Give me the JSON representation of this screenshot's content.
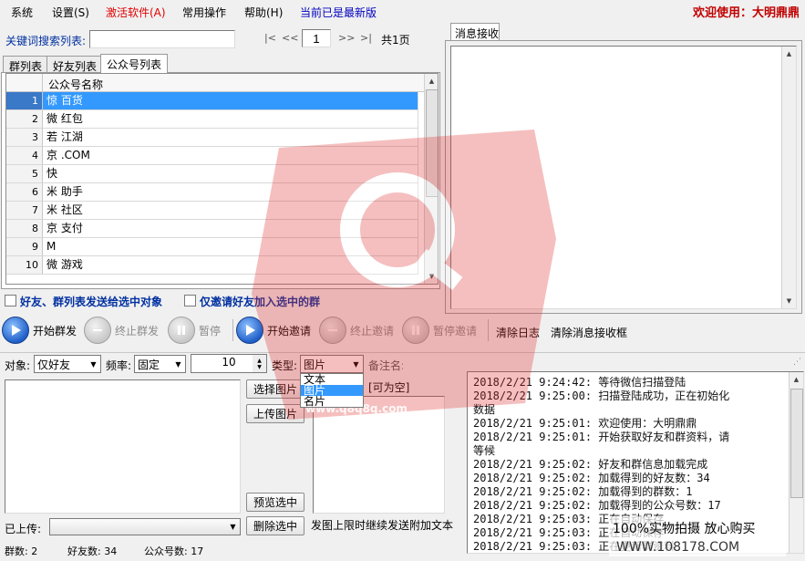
{
  "menu": {
    "items": [
      "系统",
      "设置(S)",
      "激活软件(A)",
      "常用操作",
      "帮助(H)",
      "当前已是最新版"
    ],
    "welcome": "欢迎使用：大明鼎鼎"
  },
  "colors": {
    "activate": "#e00000",
    "latest": "#0000c0",
    "welcome": "#c00000",
    "selection": "#3399ff"
  },
  "search": {
    "label": "关键词搜索列表:",
    "value": ""
  },
  "pager": {
    "first": "|<",
    "prev": "<<",
    "page": "1",
    "next": ">>",
    "last": ">|",
    "total": "共1页"
  },
  "tabs": [
    "群列表",
    "好友列表",
    "公众号列表"
  ],
  "active_tab": "公众号列表",
  "grid": {
    "header": "公众号名称",
    "rows": [
      {
        "n": "1",
        "name": "惊   百货"
      },
      {
        "n": "2",
        "name": "微   红包"
      },
      {
        "n": "3",
        "name": "若   江湖"
      },
      {
        "n": "4",
        "name": "京   .COM"
      },
      {
        "n": "5",
        "name": "快"
      },
      {
        "n": "6",
        "name": "米   助手"
      },
      {
        "n": "7",
        "name": "米   社区"
      },
      {
        "n": "8",
        "name": "京   支付"
      },
      {
        "n": "9",
        "name": "M"
      },
      {
        "n": "10",
        "name": "微   游戏"
      }
    ],
    "selected_row": "1"
  },
  "right_panel": {
    "tab": "消息接收"
  },
  "checks": {
    "send_selected": "好友、群列表发送给选中对象",
    "invite_only": "仅邀请好友加入选中的群"
  },
  "toolbar": {
    "start_group": "开始群发",
    "stop_group": "终止群发",
    "pause": "暂停",
    "start_invite": "开始邀请",
    "stop_invite": "终止邀请",
    "pause_invite": "暂停邀请",
    "clear_log": "清除日志",
    "clear_msg": "清除消息接收框"
  },
  "controls": {
    "target_label": "对象:",
    "target_value": "仅好友",
    "freq_label": "频率:",
    "freq_value": "固定",
    "interval_value": "10",
    "type_label": "类型:",
    "type_value": "图片",
    "type_options": [
      "文本",
      "图片",
      "名片"
    ],
    "remark_label": "备注名:",
    "remark_hint": "[可为空]",
    "select_image": "选择图片",
    "upload_image": "上传图片",
    "preview": "预览选中",
    "delete": "删除选中",
    "uploaded_label": "已上传:",
    "footnote": "发图上限时继续发送附加文本"
  },
  "log": [
    "2018/2/21  9:24:42: 等待微信扫描登陆",
    "2018/2/21  9:25:00: 扫描登陆成功，正在初始化",
    "数据",
    "2018/2/21  9:25:01: 欢迎使用：大明鼎鼎",
    "2018/2/21  9:25:01: 开始获取好友和群资料，请",
    "等候",
    "2018/2/21  9:25:02: 好友和群信息加载完成",
    "2018/2/21  9:25:02: 加载得到的好友数：34",
    "2018/2/21  9:25:02: 加载得到的群数：1",
    "2018/2/21  9:25:02: 加载得到的公众号数：17",
    "2018/2/21  9:25:03: 正在自动保存",
    "2018/2/21  9:25:03: 正在自动保存",
    "2018/2/21  9:25:03: 正在更新群资料"
  ],
  "status": {
    "groups": "群数: 2",
    "friends": "好友数: 34",
    "accounts": "公众号数: 17"
  },
  "watermarks": {
    "site1": "www.q8q8q.com",
    "badge_line1": "100%实物拍摄 放心购买",
    "badge_line2": "WWW.108178.COM"
  }
}
